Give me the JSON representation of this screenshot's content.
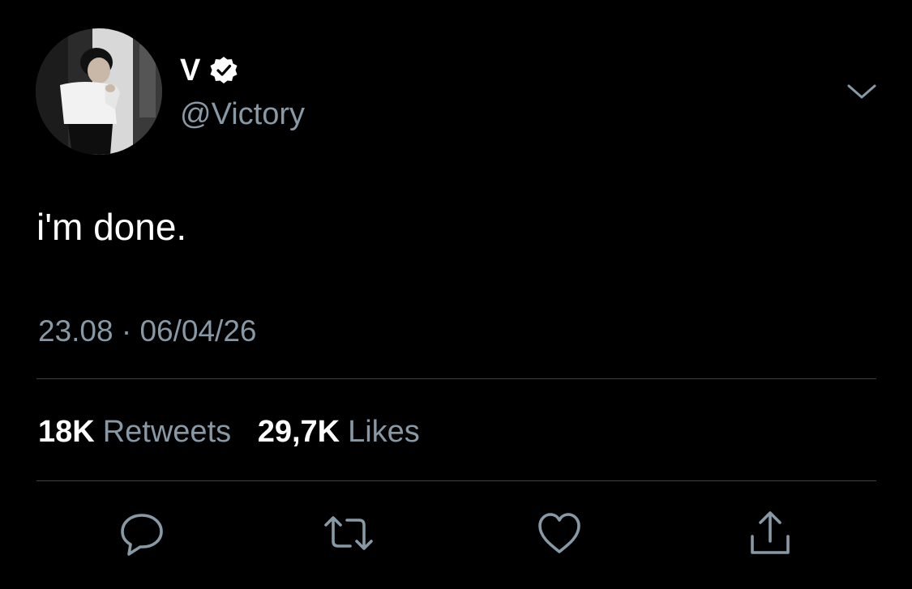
{
  "tweet": {
    "display_name": "V",
    "verified": true,
    "handle": "@Victory",
    "text": "i'm done.",
    "timestamp": "23.08 · 06/04/26"
  },
  "stats": {
    "retweets_count": "18K",
    "retweets_label": "Retweets",
    "likes_count": "29,7K",
    "likes_label": "Likes"
  },
  "actions": {
    "reply_icon": "speech-bubble-icon",
    "retweet_icon": "retweet-arrows-icon",
    "like_icon": "heart-icon",
    "share_icon": "share-upload-icon"
  },
  "colors": {
    "background": "#000000",
    "primary_text": "#ffffff",
    "secondary_text": "#8899a6",
    "divider": "#38444d"
  }
}
